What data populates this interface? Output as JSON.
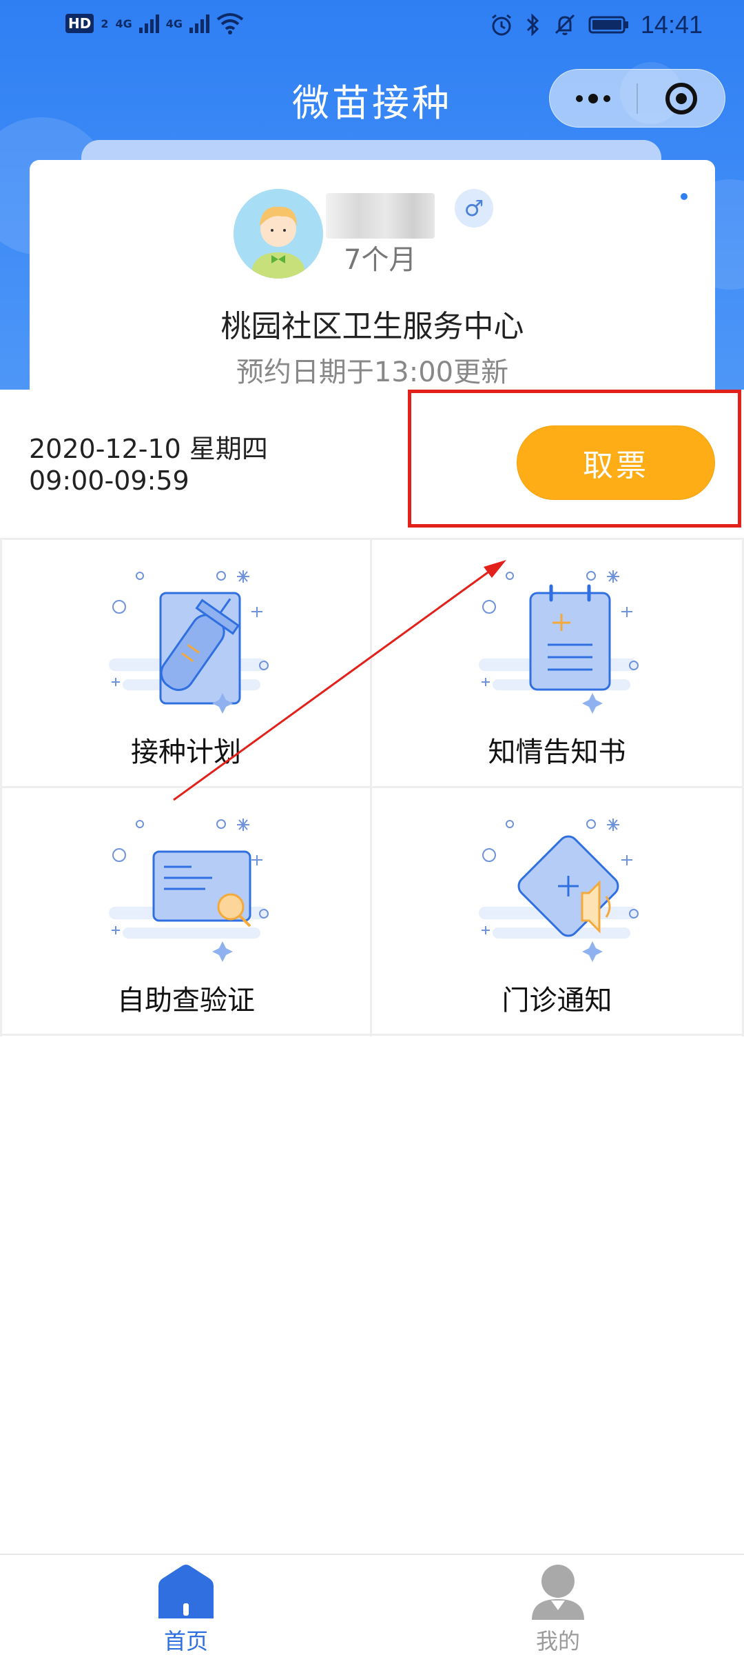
{
  "status_bar": {
    "hd_label": "HD",
    "hd_sub": "2",
    "net1": "4G",
    "net2": "4G",
    "time": "14:41"
  },
  "header": {
    "title": "微苗接种"
  },
  "profile": {
    "age": "7个月",
    "gender_symbol": "♂",
    "clinic": "桃园社区卫生服务中心",
    "update_note": "预约日期于13:00更新"
  },
  "appointment": {
    "date": "2020-12-10 星期四",
    "time_range": "09:00-09:59",
    "cancel_label": "取票"
  },
  "menu": [
    {
      "label": "接种计划"
    },
    {
      "label": "知情告知书"
    },
    {
      "label": "自助查验证"
    },
    {
      "label": "门诊通知"
    }
  ],
  "tabbar": {
    "home_label": "首页",
    "mine_label": "我的"
  },
  "colors": {
    "primary": "#2f7ff3",
    "accent_button": "#ffad16",
    "annotation_red": "#e3211b"
  }
}
